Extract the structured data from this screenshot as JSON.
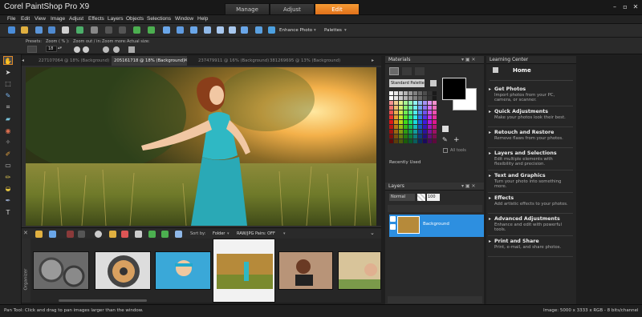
{
  "app": {
    "title": "Corel PaintShop Pro X9"
  },
  "workspace_tabs": [
    "Manage",
    "Adjust",
    "Edit"
  ],
  "active_workspace": "Edit",
  "window_controls": {
    "minimize": "–",
    "maximize": "▫",
    "close": "✕"
  },
  "menu": [
    "File",
    "Edit",
    "View",
    "Image",
    "Adjust",
    "Effects",
    "Layers",
    "Objects",
    "Selections",
    "Window",
    "Help"
  ],
  "toolbar": {
    "enhance_photo": "Enhance Photo",
    "palettes": "Palettes"
  },
  "tool_options": {
    "presets_label": "Presets:",
    "zoom_pct_label": "Zoom ( % ):",
    "zoom_value": "18",
    "zoom_out_in_label": "Zoom out / in:",
    "zoom_more_label": "Zoom more:",
    "actual_size_label": "Actual size:"
  },
  "doc_tabs": [
    {
      "label": "227107064 @ 18% (Background)",
      "active": false
    },
    {
      "label": "205161718 @ 18% (Background)",
      "active": true
    },
    {
      "label": "237479911 @ 16% (Background)",
      "active": false
    },
    {
      "label": "381269695 @ 13% (Background)",
      "active": false
    }
  ],
  "organizer": {
    "side_label": "Organizer",
    "sort_by_label": "Sort by:",
    "sort_by_value": "Folder",
    "raw_jpg_label": "RAW/JPG Pairs: OFF"
  },
  "status": {
    "left": "Pan Tool: Click and drag to pan images larger than the window.",
    "right": "Image:  5000 x 3333 x RGB - 8 bits/channel"
  },
  "materials": {
    "title": "Materials",
    "palette_select": "Standard Palette",
    "recently_used": "Recently Used",
    "all_tools": "All tools"
  },
  "layers": {
    "title": "Layers",
    "blend_mode": "Normal",
    "opacity": "100",
    "layer_name": "Background"
  },
  "learning_center": {
    "title": "Learning Center",
    "home": "Home",
    "items": [
      {
        "title": "Get Photos",
        "desc": "Import photos from your PC, camera, or scanner."
      },
      {
        "title": "Quick Adjustments",
        "desc": "Make your photos look their best."
      },
      {
        "title": "Retouch and Restore",
        "desc": "Remove flaws from your photos."
      },
      {
        "title": "Layers and Selections",
        "desc": "Edit multiple elements with flexibility and precision."
      },
      {
        "title": "Text and Graphics",
        "desc": "Turn your photo into something more."
      },
      {
        "title": "Effects",
        "desc": "Add artistic effects to your photos."
      },
      {
        "title": "Advanced Adjustments",
        "desc": "Enhance and edit with powerful tools."
      },
      {
        "title": "Print and Share",
        "desc": "Print, e-mail, and share photos."
      }
    ]
  },
  "colors": {
    "accent": "#f08a2a",
    "layer_selected": "#2d8fe0",
    "panel_bg": "#2a2a2a"
  }
}
